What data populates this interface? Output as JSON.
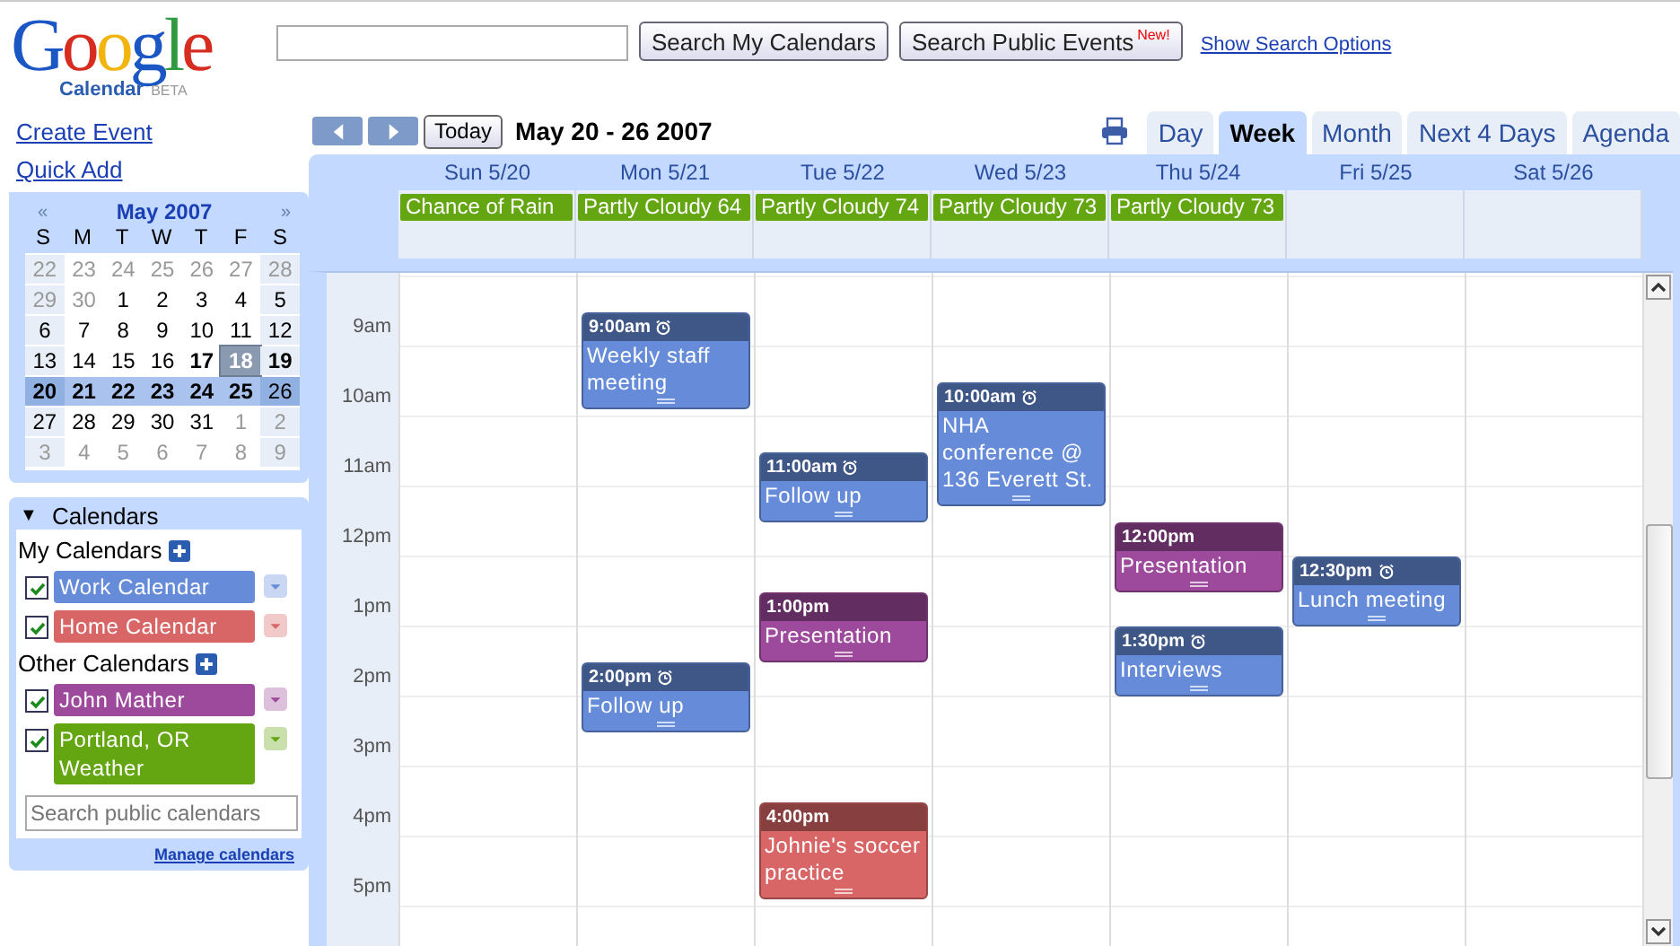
{
  "logo": {
    "letters": [
      {
        "text": "G",
        "color": "#1a56c4"
      },
      {
        "text": "o",
        "color": "#d62d20"
      },
      {
        "text": "o",
        "color": "#f2b50f"
      },
      {
        "text": "g",
        "color": "#1a56c4"
      },
      {
        "text": "l",
        "color": "#2f9a3f"
      },
      {
        "text": "e",
        "color": "#d62d20"
      }
    ],
    "product": "Calendar",
    "badge": "BETA"
  },
  "search": {
    "buttons": [
      "Search My Calendars",
      "Search Public Events"
    ],
    "new_badge": "New!",
    "options_link": "Show Search Options"
  },
  "actions": [
    "Create Event",
    "Quick Add"
  ],
  "mini_calendar": {
    "prev": "«",
    "title": "May 2007",
    "next": "»",
    "weekdays": [
      "S",
      "M",
      "T",
      "W",
      "T",
      "F",
      "S"
    ],
    "weeks": [
      {
        "selected": false,
        "days": [
          {
            "text": "22",
            "muted": true,
            "bold": false,
            "today": false
          },
          {
            "text": "23",
            "muted": true,
            "bold": false,
            "today": false
          },
          {
            "text": "24",
            "muted": true,
            "bold": false,
            "today": false
          },
          {
            "text": "25",
            "muted": true,
            "bold": false,
            "today": false
          },
          {
            "text": "26",
            "muted": true,
            "bold": false,
            "today": false
          },
          {
            "text": "27",
            "muted": true,
            "bold": false,
            "today": false
          },
          {
            "text": "28",
            "muted": true,
            "bold": false,
            "today": false
          }
        ]
      },
      {
        "selected": false,
        "days": [
          {
            "text": "29",
            "muted": true,
            "bold": false,
            "today": false
          },
          {
            "text": "30",
            "muted": true,
            "bold": false,
            "today": false
          },
          {
            "text": "1",
            "muted": false,
            "bold": false,
            "today": false
          },
          {
            "text": "2",
            "muted": false,
            "bold": false,
            "today": false
          },
          {
            "text": "3",
            "muted": false,
            "bold": false,
            "today": false
          },
          {
            "text": "4",
            "muted": false,
            "bold": false,
            "today": false
          },
          {
            "text": "5",
            "muted": false,
            "bold": false,
            "today": false
          }
        ]
      },
      {
        "selected": false,
        "days": [
          {
            "text": "6",
            "muted": false,
            "bold": false,
            "today": false
          },
          {
            "text": "7",
            "muted": false,
            "bold": false,
            "today": false
          },
          {
            "text": "8",
            "muted": false,
            "bold": false,
            "today": false
          },
          {
            "text": "9",
            "muted": false,
            "bold": false,
            "today": false
          },
          {
            "text": "10",
            "muted": false,
            "bold": false,
            "today": false
          },
          {
            "text": "11",
            "muted": false,
            "bold": false,
            "today": false
          },
          {
            "text": "12",
            "muted": false,
            "bold": false,
            "today": false
          }
        ]
      },
      {
        "selected": false,
        "days": [
          {
            "text": "13",
            "muted": false,
            "bold": false,
            "today": false
          },
          {
            "text": "14",
            "muted": false,
            "bold": false,
            "today": false
          },
          {
            "text": "15",
            "muted": false,
            "bold": false,
            "today": false
          },
          {
            "text": "16",
            "muted": false,
            "bold": false,
            "today": false
          },
          {
            "text": "17",
            "muted": false,
            "bold": true,
            "today": false
          },
          {
            "text": "18",
            "muted": false,
            "bold": true,
            "today": true
          },
          {
            "text": "19",
            "muted": false,
            "bold": true,
            "today": false
          }
        ]
      },
      {
        "selected": true,
        "days": [
          {
            "text": "20",
            "muted": false,
            "bold": true,
            "today": false
          },
          {
            "text": "21",
            "muted": false,
            "bold": true,
            "today": false
          },
          {
            "text": "22",
            "muted": false,
            "bold": true,
            "today": false
          },
          {
            "text": "23",
            "muted": false,
            "bold": true,
            "today": false
          },
          {
            "text": "24",
            "muted": false,
            "bold": true,
            "today": false
          },
          {
            "text": "25",
            "muted": false,
            "bold": true,
            "today": false
          },
          {
            "text": "26",
            "muted": false,
            "bold": false,
            "today": false
          }
        ]
      },
      {
        "selected": false,
        "days": [
          {
            "text": "27",
            "muted": false,
            "bold": false,
            "today": false
          },
          {
            "text": "28",
            "muted": false,
            "bold": false,
            "today": false
          },
          {
            "text": "29",
            "muted": false,
            "bold": false,
            "today": false
          },
          {
            "text": "30",
            "muted": false,
            "bold": false,
            "today": false
          },
          {
            "text": "31",
            "muted": false,
            "bold": false,
            "today": false
          },
          {
            "text": "1",
            "muted": true,
            "bold": false,
            "today": false
          },
          {
            "text": "2",
            "muted": true,
            "bold": false,
            "today": false
          }
        ]
      },
      {
        "selected": false,
        "days": [
          {
            "text": "3",
            "muted": true,
            "bold": false,
            "today": false
          },
          {
            "text": "4",
            "muted": true,
            "bold": false,
            "today": false
          },
          {
            "text": "5",
            "muted": true,
            "bold": false,
            "today": false
          },
          {
            "text": "6",
            "muted": true,
            "bold": false,
            "today": false
          },
          {
            "text": "7",
            "muted": true,
            "bold": false,
            "today": false
          },
          {
            "text": "8",
            "muted": true,
            "bold": false,
            "today": false
          },
          {
            "text": "9",
            "muted": true,
            "bold": false,
            "today": false
          }
        ]
      }
    ]
  },
  "calendars": {
    "toggle": "▼",
    "title": "Calendars",
    "expanded": true,
    "groups": [
      {
        "title": "My Calendars",
        "items": [
          {
            "name": "Work Calendar",
            "checked": true,
            "color": "#668cd9"
          },
          {
            "name": "Home Calendar",
            "checked": true,
            "color": "#d96666"
          }
        ]
      },
      {
        "title": "Other Calendars",
        "items": [
          {
            "name": "John Mather",
            "checked": true,
            "color": "#9e4a9c"
          },
          {
            "name": "Portland, OR Weather",
            "checked": true,
            "color": "#64a611"
          }
        ]
      }
    ],
    "search_placeholder": "Search public calendars",
    "manage_link": "Manage calendars"
  },
  "toolbar": {
    "today": "Today",
    "range": "May 20 - 26 2007",
    "tabs": [
      {
        "label": "Day",
        "selected": false
      },
      {
        "label": "Week",
        "selected": true
      },
      {
        "label": "Month",
        "selected": false
      },
      {
        "label": "Next 4 Days",
        "selected": false
      },
      {
        "label": "Agenda",
        "selected": false
      }
    ]
  },
  "hours": [
    "9am",
    "10am",
    "11am",
    "12pm",
    "1pm",
    "2pm",
    "3pm",
    "4pm",
    "5pm"
  ],
  "days": [
    {
      "label": "Sun 5/20",
      "allday": {
        "title": "Chance of Rain",
        "color": "#64a611"
      }
    },
    {
      "label": "Mon 5/21",
      "allday": {
        "title": "Partly Cloudy 64",
        "color": "#64a611"
      },
      "events": [
        {
          "time": "9:00am",
          "title": "Weekly staff meeting",
          "alarm": true,
          "color": "#668cd9"
        },
        {
          "time": "2:00pm",
          "title": "Follow up",
          "alarm": true,
          "color": "#668cd9"
        }
      ]
    },
    {
      "label": "Tue 5/22",
      "allday": {
        "title": "Partly Cloudy 74",
        "color": "#64a611"
      },
      "events": [
        {
          "time": "11:00am",
          "title": "Follow up",
          "alarm": true,
          "color": "#668cd9"
        },
        {
          "time": "1:00pm",
          "title": "Presentation",
          "alarm": false,
          "color": "#9e4a9c"
        },
        {
          "time": "4:00pm",
          "title": "Johnie's soccer practice",
          "alarm": false,
          "color": "#d96666"
        }
      ]
    },
    {
      "label": "Wed 5/23",
      "allday": {
        "title": "Partly Cloudy 73",
        "color": "#64a611"
      },
      "events": [
        {
          "time": "10:00am",
          "title": "NHA conference @ 136 Everett St.",
          "alarm": true,
          "color": "#668cd9"
        }
      ]
    },
    {
      "label": "Thu 5/24",
      "allday": {
        "title": "Partly Cloudy 73",
        "color": "#64a611"
      },
      "events": [
        {
          "time": "12:00pm",
          "title": "Presentation",
          "alarm": false,
          "color": "#9e4a9c"
        },
        {
          "time": "1:30pm",
          "title": "Interviews",
          "alarm": true,
          "color": "#668cd9"
        }
      ]
    },
    {
      "label": "Fri 5/25",
      "events": [
        {
          "time": "12:30pm",
          "title": "Lunch meeting",
          "alarm": true,
          "color": "#668cd9"
        }
      ]
    },
    {
      "label": "Sat 5/26"
    }
  ]
}
